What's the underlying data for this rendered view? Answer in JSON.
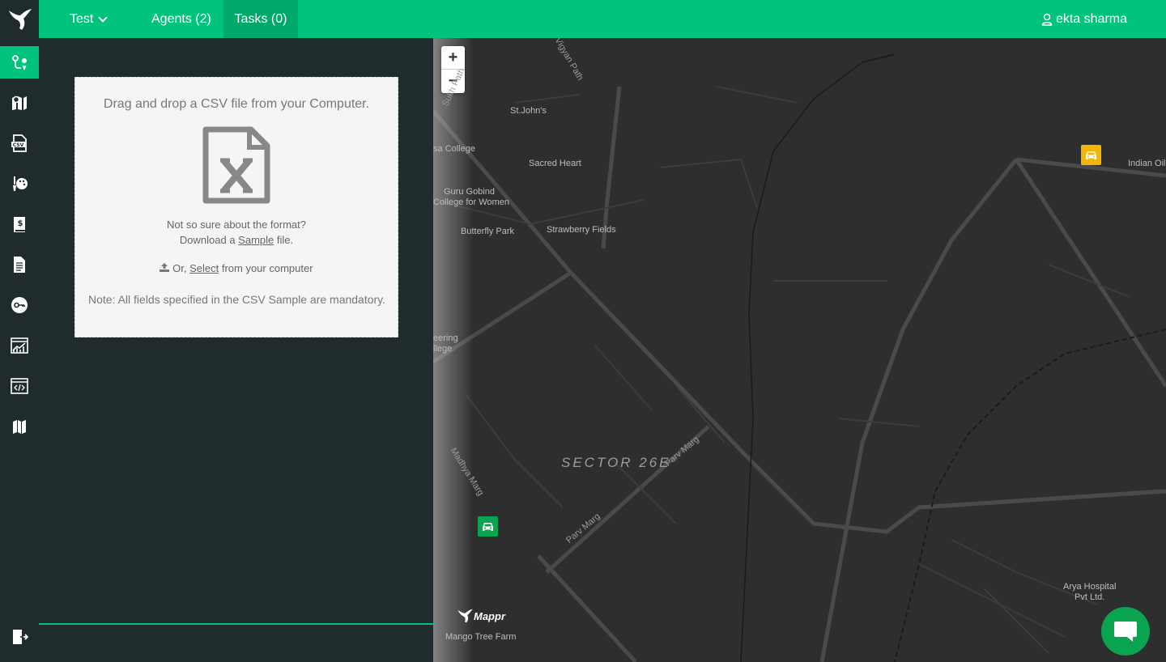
{
  "topbar": {
    "logo_icon": "bird-logo-icon",
    "project_label": "Test",
    "agents_label": "Agents (2)",
    "tasks_label": "Tasks (0)",
    "user_name": "ekta sharma",
    "accent_color": "#00c47d"
  },
  "sidebar": {
    "items": [
      {
        "icon": "route-pin-icon",
        "active": true
      },
      {
        "icon": "map-pin-icon",
        "active": false
      },
      {
        "icon": "csv-file-icon",
        "active": false
      },
      {
        "icon": "palette-brush-icon",
        "active": false
      },
      {
        "icon": "billing-book-icon",
        "active": false
      },
      {
        "icon": "document-icon",
        "active": false
      },
      {
        "icon": "key-icon",
        "active": false
      },
      {
        "icon": "analytics-chart-icon",
        "active": false
      },
      {
        "icon": "code-window-icon",
        "active": false
      },
      {
        "icon": "folded-map-icon",
        "active": false
      }
    ],
    "logout_icon": "logout-icon"
  },
  "upload": {
    "title": "Drag and drop a CSV file from your Computer.",
    "format_line": "Not so sure about the format?",
    "download_prefix": "Download a",
    "sample_link": "Sample",
    "download_suffix": "file.",
    "or_prefix": "Or,",
    "select_link": "Select",
    "select_suffix": "from your computer",
    "note": "Note: All fields specified in the CSV Sample are mandatory."
  },
  "map": {
    "zoom_in": "+",
    "zoom_out": "−",
    "sector_label": "SECTOR 26E",
    "places": {
      "stjohns": "St.John's",
      "sacred_heart": "Sacred Heart",
      "sa_college": "sa College",
      "guru_gobind_1": "Guru Gobind",
      "guru_gobind_2": "College for Women",
      "butterfly_park": "Butterfly Park",
      "strawberry_fields": "Strawberry Fields",
      "engineering_1": "eering",
      "engineering_2": "llege",
      "indian_oil": "Indian Oil",
      "arya_1": "Arya Hospital",
      "arya_2": "Pvt Ltd.",
      "mango_tree": "Mango Tree Farm"
    },
    "roads": {
      "vigyan_path": "Vigyan Path",
      "sukh_path": "Sukh Path",
      "madhya_marg": "Madhya Marg",
      "parv_marg_1": "Parv Marg",
      "parv_marg_2": "Parv Marg"
    },
    "brand": "Mappr",
    "markers": [
      {
        "name": "agent-yellow",
        "color": "#f2b705"
      },
      {
        "name": "agent-green",
        "color": "#0aa34f"
      }
    ]
  }
}
